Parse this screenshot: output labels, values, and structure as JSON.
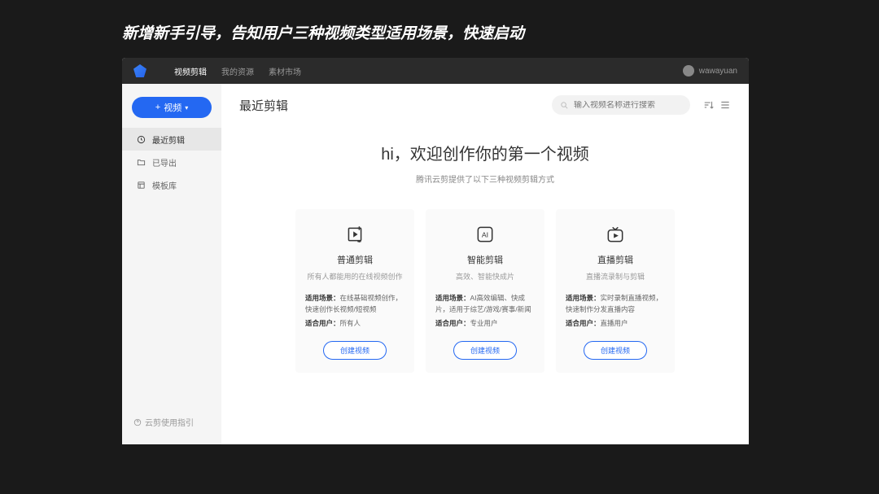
{
  "annotation": "新增新手引导，告知用户三种视频类型适用场景，快速启动",
  "nav": {
    "items": [
      "视频剪辑",
      "我的资源",
      "素材市场"
    ],
    "active_index": 0
  },
  "user": {
    "name": "wawayuan"
  },
  "sidebar": {
    "new_btn": "视频",
    "items": [
      {
        "icon": "clock",
        "label": "最近剪辑"
      },
      {
        "icon": "folder",
        "label": "已导出"
      },
      {
        "icon": "template",
        "label": "模板库"
      }
    ],
    "active_index": 0,
    "footer": "云剪使用指引"
  },
  "main": {
    "title": "最近剪辑",
    "search_placeholder": "输入视频名称进行搜索"
  },
  "welcome": {
    "heading": "hi，欢迎创作你的第一个视频",
    "subheading": "腾讯云剪提供了以下三种视频剪辑方式"
  },
  "cards": [
    {
      "title": "普通剪辑",
      "subtitle": "所有人都能用的在线视频创作",
      "scene_label": "适用场景：",
      "scene": "在线基础视频创作，快速创作长视频/短视频",
      "user_label": "适合用户：",
      "user": "所有人",
      "button": "创建视频"
    },
    {
      "title": "智能剪辑",
      "subtitle": "高效、智能快成片",
      "scene_label": "适用场景：",
      "scene": "AI高效编辑、快成片，适用于综艺/游戏/赛事/新闻",
      "user_label": "适合用户：",
      "user": "专业用户",
      "button": "创建视频"
    },
    {
      "title": "直播剪辑",
      "subtitle": "直播流录制与剪辑",
      "scene_label": "适用场景：",
      "scene": "实时录制直播视频，快速制作分发直播内容",
      "user_label": "适合用户：",
      "user": "直播用户",
      "button": "创建视频"
    }
  ]
}
